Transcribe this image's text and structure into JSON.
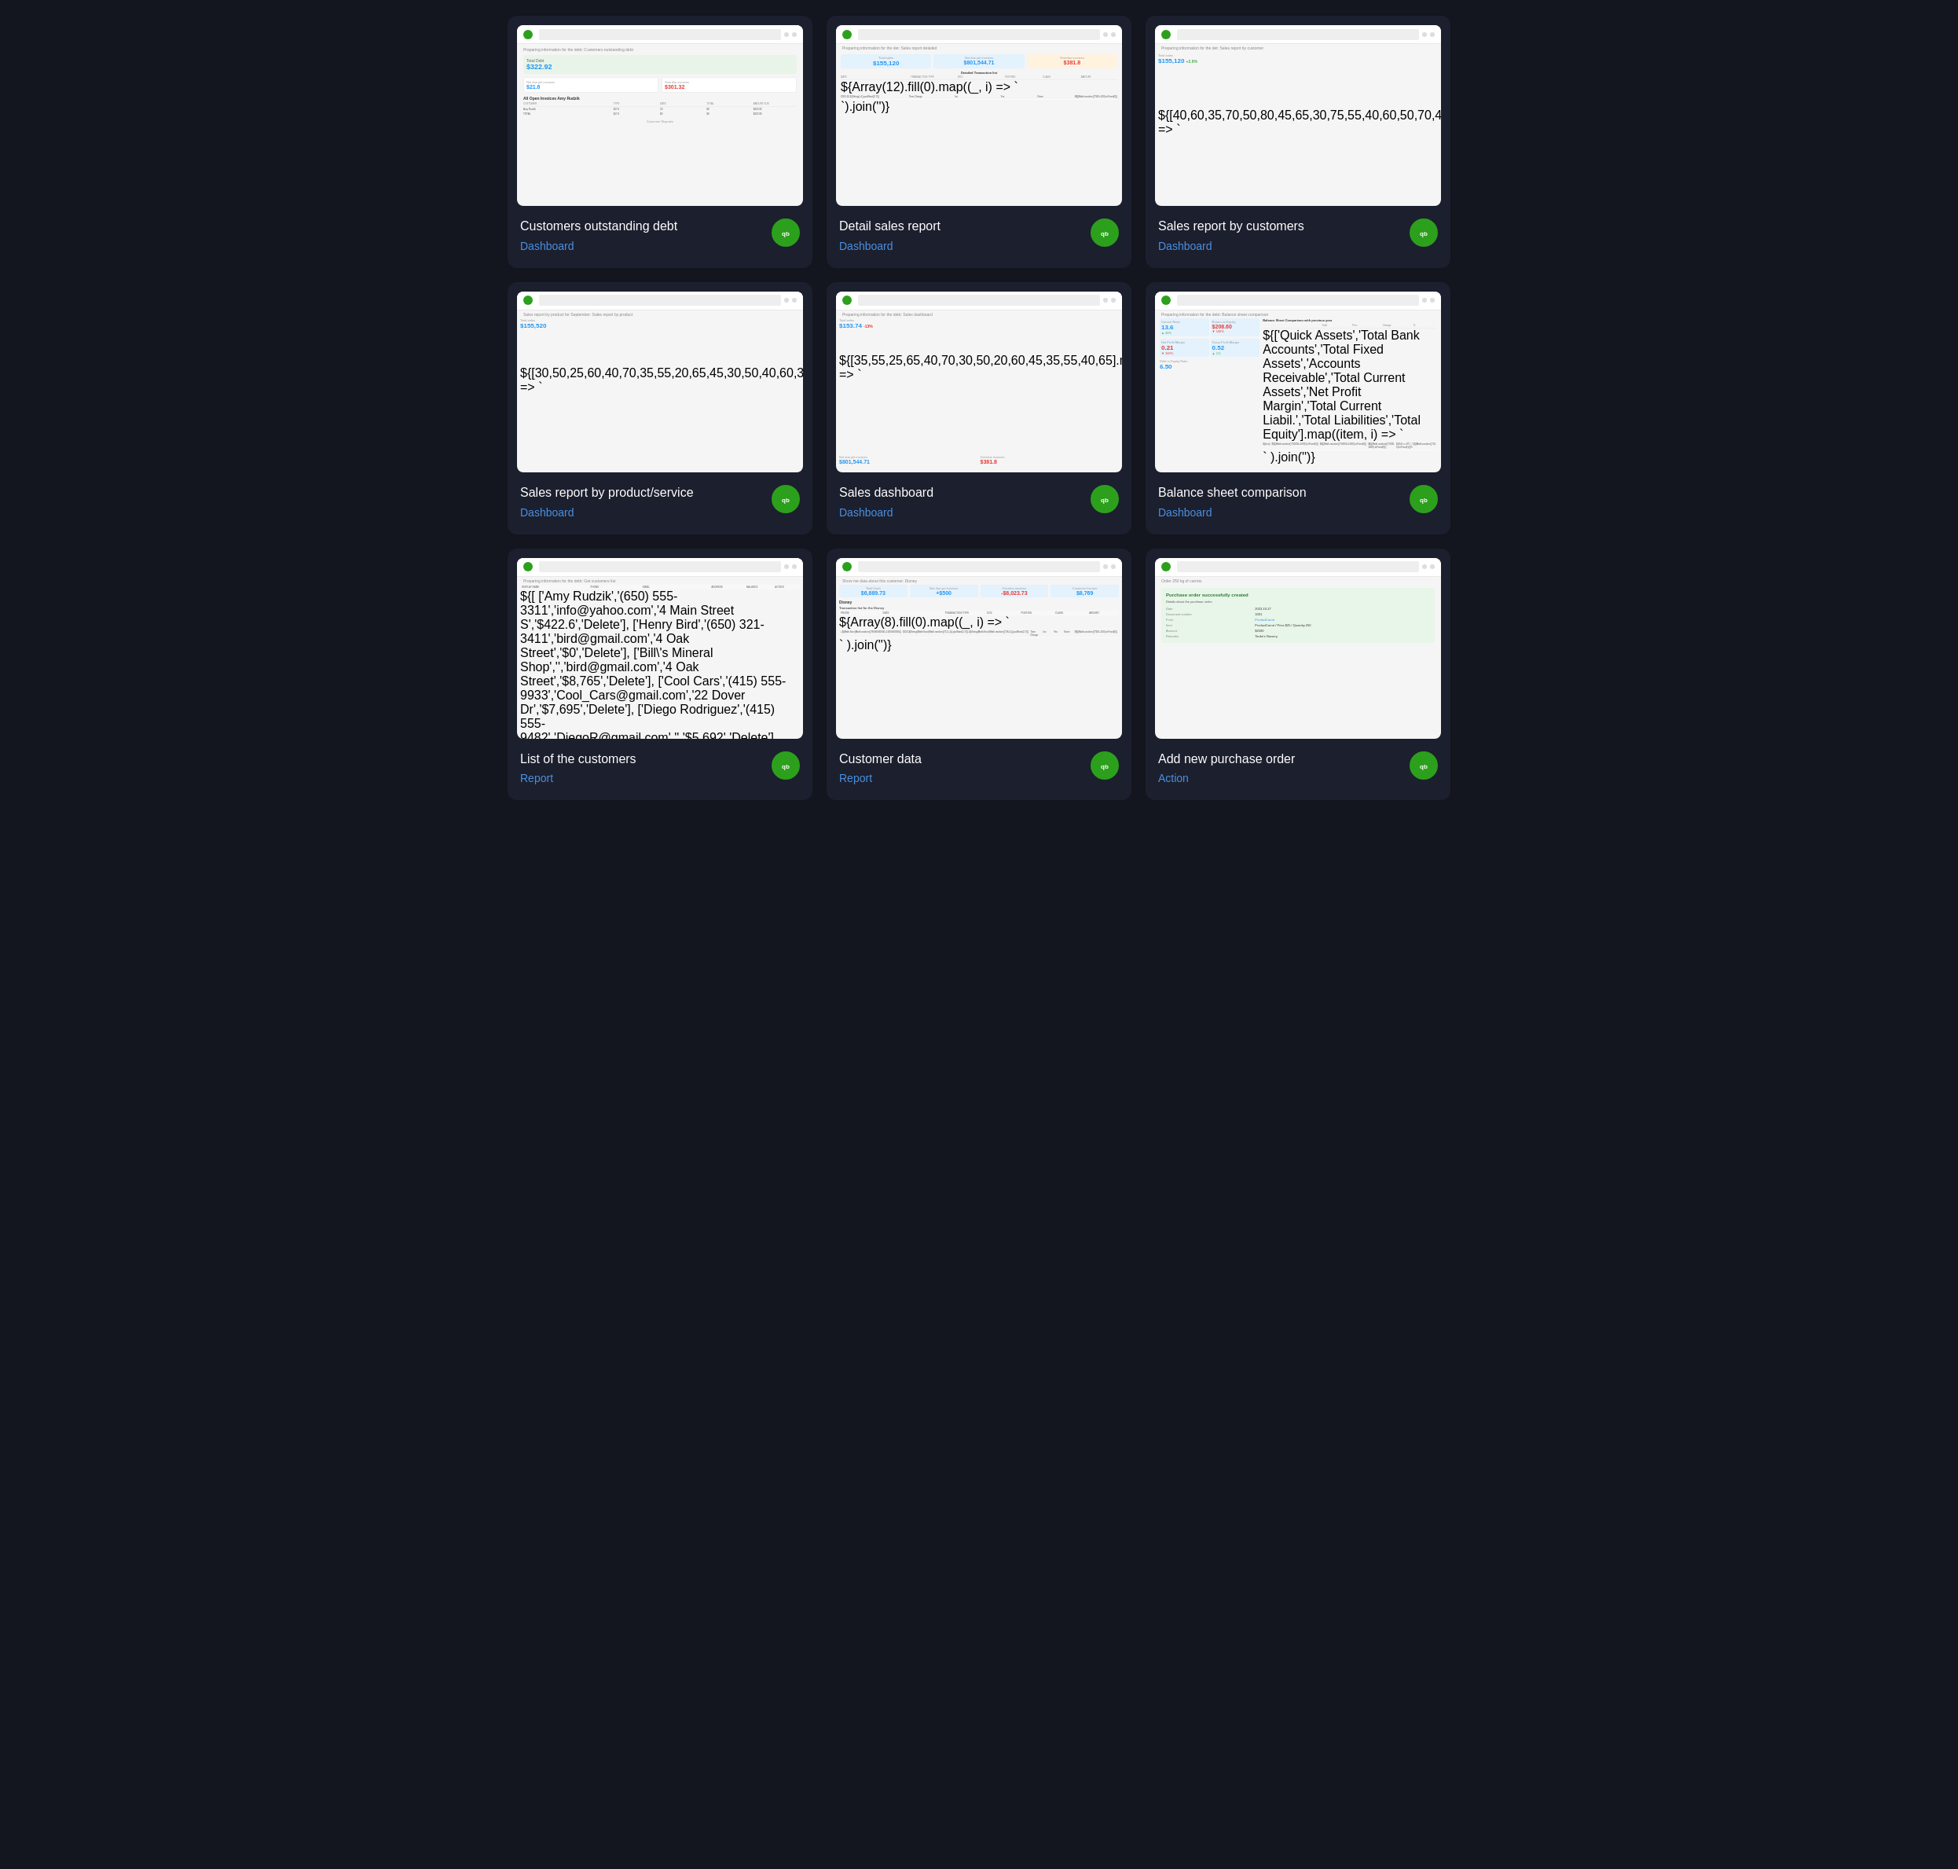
{
  "cards": [
    {
      "id": "customers-outstanding-debt",
      "title": "Customers outstanding debt",
      "subtitle": "Dashboard",
      "badge": "qb",
      "preview_type": "table_stats"
    },
    {
      "id": "detail-sales-report",
      "title": "Detail sales report",
      "subtitle": "Dashboard",
      "badge": "qb",
      "preview_type": "transaction_table"
    },
    {
      "id": "sales-report-by-customers",
      "title": "Sales report by customers",
      "subtitle": "Dashboard",
      "badge": "qb",
      "preview_type": "bar_chart_customers"
    },
    {
      "id": "sales-report-by-product",
      "title": "Sales report by product/service",
      "subtitle": "Dashboard",
      "badge": "qb",
      "preview_type": "bar_chart_product"
    },
    {
      "id": "sales-dashboard",
      "title": "Sales dashboard",
      "subtitle": "Dashboard",
      "badge": "qb",
      "preview_type": "sales_dashboard"
    },
    {
      "id": "balance-sheet-comparison",
      "title": "Balance sheet comparison",
      "subtitle": "Dashboard",
      "badge": "qb",
      "preview_type": "balance_sheet"
    },
    {
      "id": "list-of-customers",
      "title": "List of the customers",
      "subtitle": "Report",
      "badge": "qb",
      "preview_type": "customers_list"
    },
    {
      "id": "customer-data",
      "title": "Customer data",
      "subtitle": "Report",
      "badge": "qb",
      "preview_type": "customer_data"
    },
    {
      "id": "add-new-purchase-order",
      "title": "Add new purchase order",
      "subtitle": "Action",
      "badge": "qb",
      "preview_type": "purchase_order"
    }
  ]
}
